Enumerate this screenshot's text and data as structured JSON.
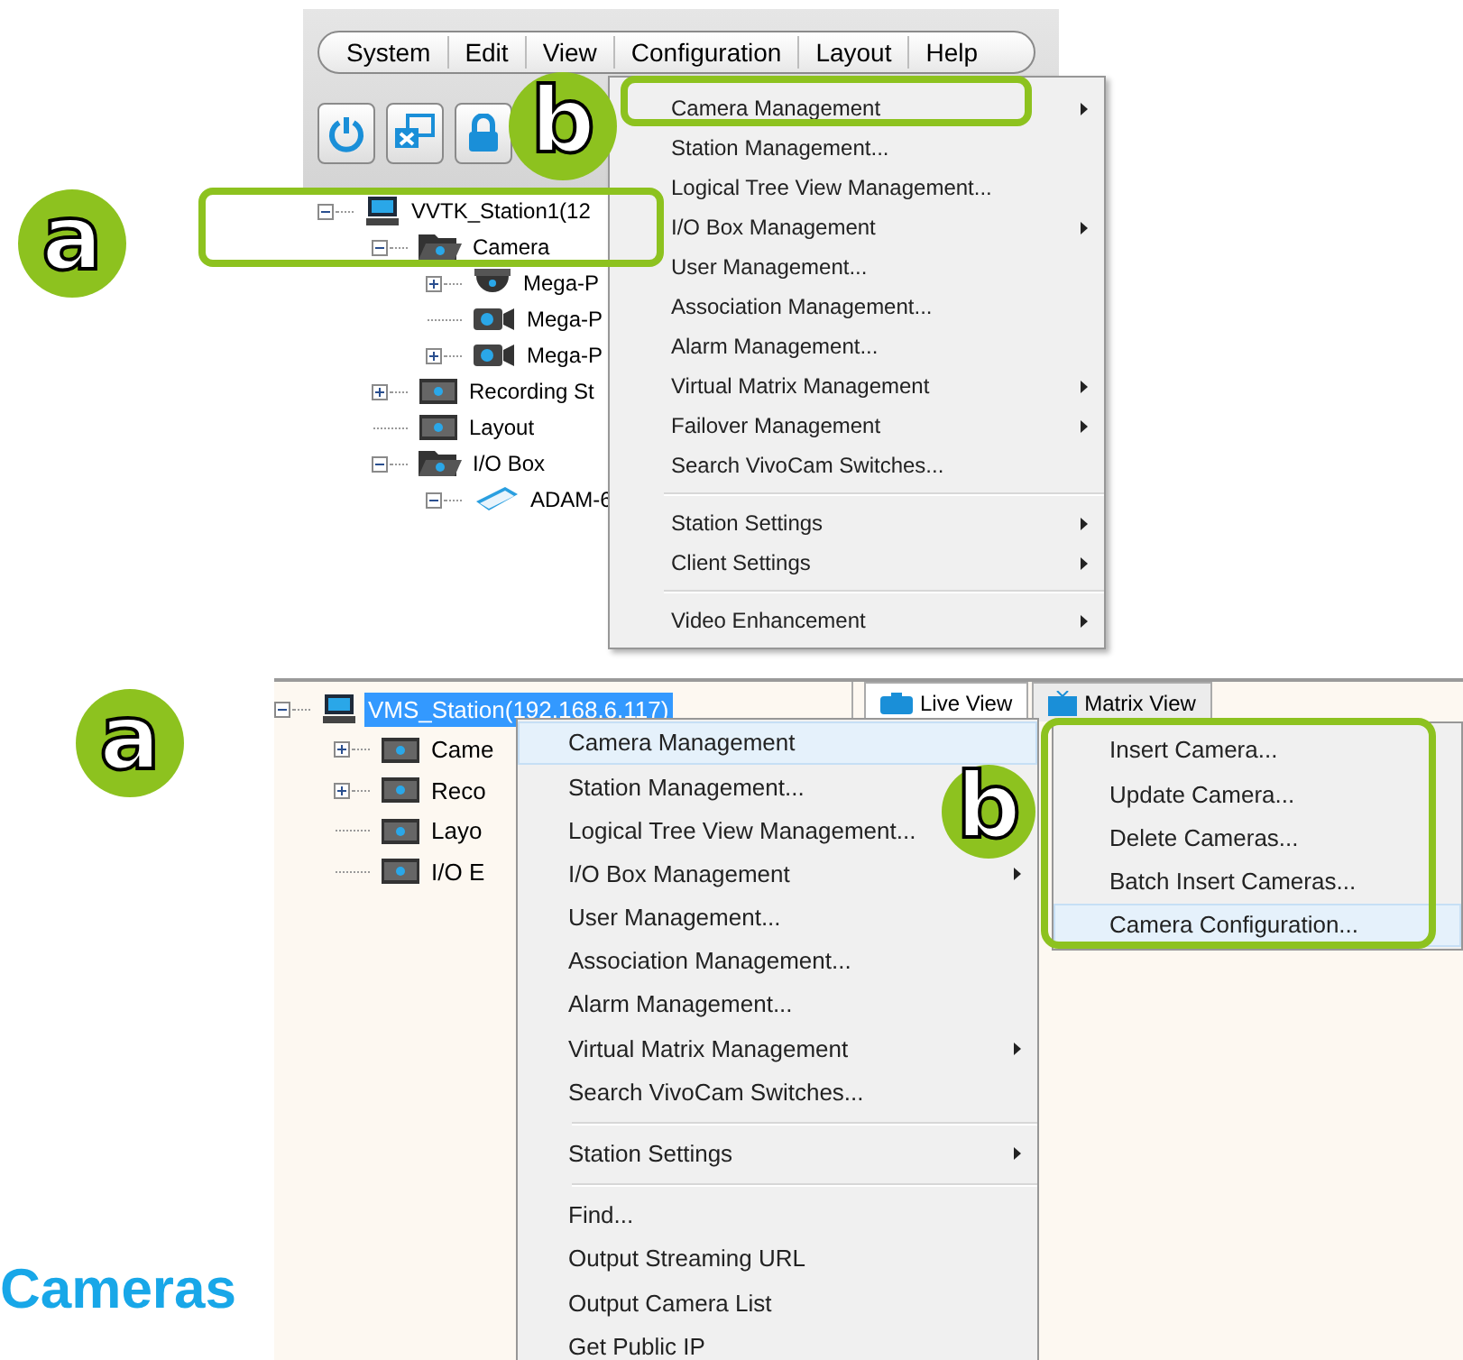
{
  "top_screenshot": {
    "callouts": [
      "a",
      "b"
    ],
    "menu_bar": [
      {
        "label": "System"
      },
      {
        "label": "Edit"
      },
      {
        "label": "View"
      },
      {
        "label": "Configuration"
      },
      {
        "label": "Layout"
      },
      {
        "label": "Help"
      }
    ],
    "toolbar": [
      {
        "kind": "power"
      },
      {
        "kind": "monitor"
      },
      {
        "kind": "lock"
      }
    ],
    "tree": [
      {
        "label": "VVTK_Station1(12",
        "kind": "station",
        "expanded": true,
        "selected": false,
        "children": [
          {
            "label": "Camera",
            "kind": "folder-open",
            "expanded": true,
            "selected": false,
            "children": [
              {
                "label": "Mega-P",
                "kind": "dome-camera",
                "expanded": false,
                "selected": false
              },
              {
                "label": "Mega-P",
                "kind": "camera",
                "selected": false
              },
              {
                "label": "Mega-P",
                "kind": "camera",
                "expanded": false,
                "selected": false
              }
            ]
          },
          {
            "label": "Recording St",
            "kind": "folder",
            "expanded": false,
            "selected": false
          },
          {
            "label": "Layout",
            "kind": "folder",
            "selected": false
          },
          {
            "label": "I/O Box",
            "kind": "folder-open",
            "expanded": true,
            "selected": false,
            "children": [
              {
                "label": "ADAM-6",
                "kind": "io-device",
                "expanded": true,
                "selected": false
              }
            ]
          }
        ]
      }
    ],
    "menu": [
      {
        "kind": "item",
        "label": "Camera Management",
        "submenu": true,
        "selected": false
      },
      {
        "kind": "item",
        "label": "Station Management...",
        "submenu": false,
        "selected": false
      },
      {
        "kind": "item",
        "label": "Logical Tree View Management...",
        "submenu": false,
        "selected": false
      },
      {
        "kind": "item",
        "label": "I/O Box Management",
        "submenu": true,
        "selected": false
      },
      {
        "kind": "item",
        "label": "User Management...",
        "submenu": false,
        "selected": false
      },
      {
        "kind": "item",
        "label": "Association Management...",
        "submenu": false,
        "selected": false
      },
      {
        "kind": "item",
        "label": "Alarm Management...",
        "submenu": false,
        "selected": false
      },
      {
        "kind": "item",
        "label": "Virtual Matrix Management",
        "submenu": true,
        "selected": false
      },
      {
        "kind": "item",
        "label": "Failover Management",
        "submenu": true,
        "selected": false
      },
      {
        "kind": "item",
        "label": "Search VivoCam Switches...",
        "submenu": false,
        "selected": false
      },
      {
        "kind": "separator"
      },
      {
        "kind": "item",
        "label": "Station Settings",
        "submenu": true,
        "selected": false
      },
      {
        "kind": "item",
        "label": "Client Settings",
        "submenu": true,
        "selected": false
      },
      {
        "kind": "separator"
      },
      {
        "kind": "item",
        "label": "Video Enhancement",
        "submenu": true,
        "selected": false
      }
    ]
  },
  "bottom_screenshot": {
    "callouts": [
      "a",
      "b"
    ],
    "tree": [
      {
        "label": "VMS_Station(192.168.6.117)",
        "kind": "station",
        "expanded": true,
        "selected": true,
        "children": [
          {
            "label": "Came",
            "kind": "folder",
            "expanded": false,
            "selected": false
          },
          {
            "label": "Reco",
            "kind": "folder",
            "expanded": false,
            "selected": false
          },
          {
            "label": "Layo",
            "kind": "folder",
            "selected": false
          },
          {
            "label": "I/O E",
            "kind": "folder",
            "selected": false
          }
        ]
      }
    ],
    "tabs": [
      {
        "label": "Live View",
        "selected": true
      },
      {
        "label": "Matrix View",
        "selected": false
      }
    ],
    "menu": [
      {
        "kind": "item",
        "label": "Camera Management",
        "submenu": false,
        "selected": true
      },
      {
        "kind": "item",
        "label": "Station Management...",
        "submenu": false,
        "selected": false
      },
      {
        "kind": "item",
        "label": "Logical Tree View Management...",
        "submenu": false,
        "selected": false
      },
      {
        "kind": "item",
        "label": "I/O Box Management",
        "submenu": true,
        "selected": false
      },
      {
        "kind": "item",
        "label": "User Management...",
        "submenu": false,
        "selected": false
      },
      {
        "kind": "item",
        "label": "Association Management...",
        "submenu": false,
        "selected": false
      },
      {
        "kind": "item",
        "label": "Alarm Management...",
        "submenu": false,
        "selected": false
      },
      {
        "kind": "item",
        "label": "Virtual Matrix Management",
        "submenu": true,
        "selected": false
      },
      {
        "kind": "item",
        "label": "Search VivoCam Switches...",
        "submenu": false,
        "selected": false
      },
      {
        "kind": "separator"
      },
      {
        "kind": "item",
        "label": "Station Settings",
        "submenu": true,
        "selected": false
      },
      {
        "kind": "separator"
      },
      {
        "kind": "item",
        "label": "Find...",
        "submenu": false,
        "selected": false
      },
      {
        "kind": "item",
        "label": "Output Streaming URL",
        "submenu": false,
        "selected": false
      },
      {
        "kind": "item",
        "label": "Output Camera List",
        "submenu": false,
        "selected": false
      },
      {
        "kind": "item",
        "label": "Get Public IP",
        "submenu": false,
        "selected": false
      }
    ],
    "submenu": [
      {
        "kind": "item",
        "label": "Insert Camera...",
        "submenu": false,
        "selected": false
      },
      {
        "kind": "item",
        "label": "Update Camera...",
        "submenu": false,
        "selected": false
      },
      {
        "kind": "item",
        "label": "Delete Cameras...",
        "submenu": false,
        "selected": false
      },
      {
        "kind": "item",
        "label": "Batch Insert Cameras...",
        "submenu": false,
        "selected": false
      },
      {
        "kind": "item",
        "label": "Camera Configuration...",
        "submenu": false,
        "selected": true
      }
    ]
  },
  "heading": "Cameras"
}
